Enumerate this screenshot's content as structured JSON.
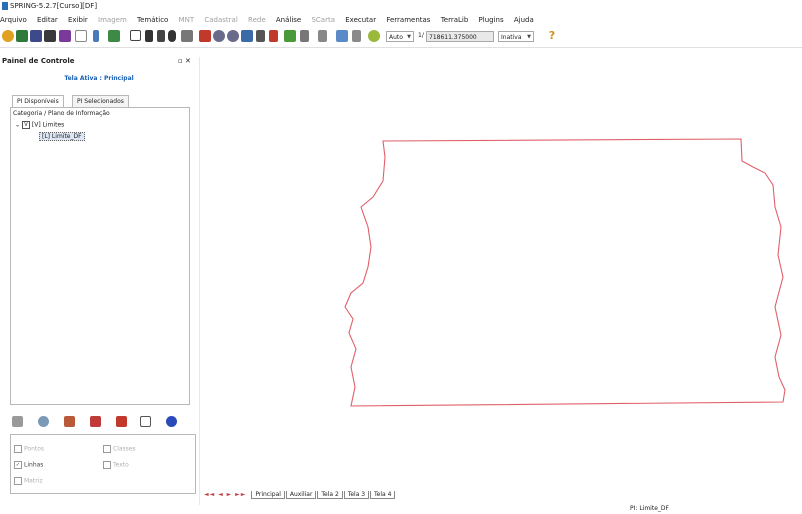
{
  "window": {
    "title": "SPRING-5.2.7[Curso][DF]"
  },
  "menu": [
    {
      "label": "Arquivo",
      "enabled": true
    },
    {
      "label": "Editar",
      "enabled": true
    },
    {
      "label": "Exibir",
      "enabled": true
    },
    {
      "label": "Imagem",
      "enabled": false
    },
    {
      "label": "Temático",
      "enabled": true
    },
    {
      "label": "MNT",
      "enabled": false
    },
    {
      "label": "Cadastral",
      "enabled": false
    },
    {
      "label": "Rede",
      "enabled": false
    },
    {
      "label": "Análise",
      "enabled": true
    },
    {
      "label": "SCarta",
      "enabled": false
    },
    {
      "label": "Executar",
      "enabled": true
    },
    {
      "label": "Ferramentas",
      "enabled": true
    },
    {
      "label": "TerraLib",
      "enabled": true
    },
    {
      "label": "Plugins",
      "enabled": true
    },
    {
      "label": "Ajuda",
      "enabled": true
    }
  ],
  "toolbar": {
    "mode_value": "Auto",
    "scale_prefix": "1/",
    "scale_value": "718611.375000",
    "projection_value": "Inativa",
    "icons": [
      "database-icon",
      "project-icon",
      "category-icon",
      "layer-icon",
      "edit-icon",
      "window-icon",
      "info-icon",
      "select-icon",
      "zoom-window-icon",
      "cursor-icon",
      "pan-icon",
      "info-point-icon",
      "measure-icon",
      "draw-icon",
      "zoom-in-icon",
      "zoom-out-icon",
      "zoom-fit-icon",
      "back-icon",
      "forward-icon",
      "undo-icon",
      "layers-icon",
      "zoom-dropdown-icon",
      "grid-icon",
      "check-icon",
      "help-icon"
    ]
  },
  "panel": {
    "title": "Painel de Controle",
    "tela_label": "Tela Ativa : Principal",
    "tabs": [
      {
        "label": "PI Disponíveis",
        "active": true
      },
      {
        "label": "PI Selecionados",
        "active": false
      }
    ],
    "tree": {
      "header": "Categoria / Plano de Informação",
      "node_label": "[V] Limites",
      "node_check": "V",
      "child_label": "[L] Limite_DF"
    },
    "tools": [
      "list-icon",
      "zoom-icon",
      "edit-visual-icon",
      "chart-icon",
      "draw-pencil-icon",
      "table-icon",
      "help-icon"
    ],
    "representations": [
      {
        "label": "Pontos",
        "checked": false,
        "enabled": false
      },
      {
        "label": "Classes",
        "checked": false,
        "enabled": false
      },
      {
        "label": "Linhas",
        "checked": true,
        "enabled": true
      },
      {
        "label": "Texto",
        "checked": false,
        "enabled": false
      },
      {
        "label": "Matriz",
        "checked": false,
        "enabled": false
      }
    ]
  },
  "canvas": {
    "feature": "Limite_DF",
    "stroke_color": "#e0606a"
  },
  "bottom_tabs": {
    "nav": "◄◄ ◄ ► ►►",
    "tabs": [
      "Principal",
      "Auxiliar",
      "Tela 2",
      "Tela 3",
      "Tela 4"
    ]
  },
  "status": {
    "text": "PI: Limite_DF"
  }
}
